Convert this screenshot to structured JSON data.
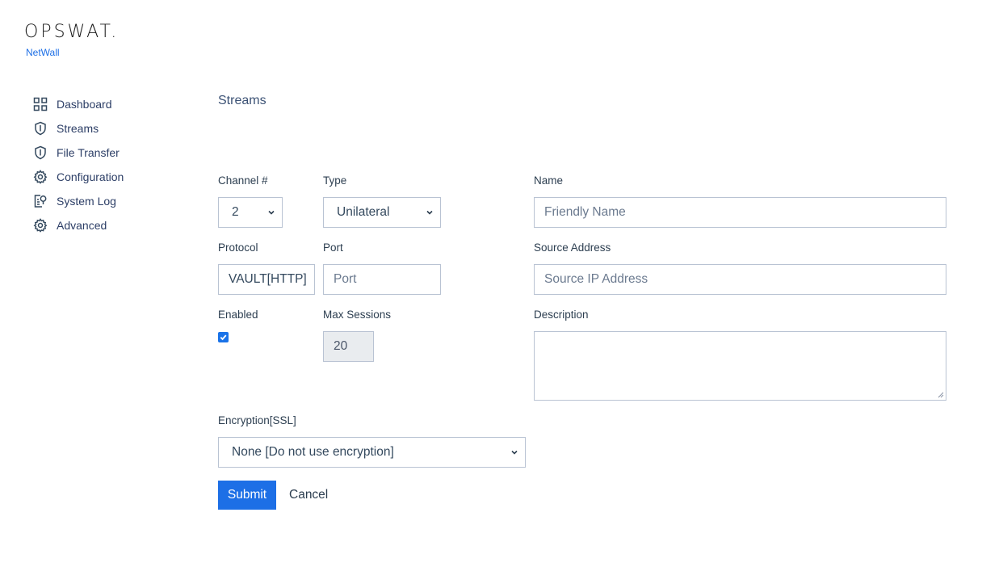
{
  "brand": {
    "name": "OPSWAT.",
    "product": "NetWall"
  },
  "sidebar": {
    "items": [
      {
        "label": "Dashboard",
        "icon": "dashboard-grid-icon"
      },
      {
        "label": "Streams",
        "icon": "shield-icon"
      },
      {
        "label": "File Transfer",
        "icon": "shield-icon"
      },
      {
        "label": "Configuration",
        "icon": "gear-icon"
      },
      {
        "label": "System Log",
        "icon": "log-search-icon"
      },
      {
        "label": "Advanced",
        "icon": "gear-icon"
      }
    ]
  },
  "page": {
    "title": "Streams"
  },
  "form": {
    "channel": {
      "label": "Channel #",
      "value": "2"
    },
    "type": {
      "label": "Type",
      "value": "Unilateral"
    },
    "name": {
      "label": "Name",
      "placeholder": "Friendly Name"
    },
    "protocol": {
      "label": "Protocol",
      "value": "VAULT[HTTP]"
    },
    "port": {
      "label": "Port",
      "placeholder": "Port"
    },
    "source_address": {
      "label": "Source Address",
      "placeholder": "Source IP Address"
    },
    "enabled": {
      "label": "Enabled",
      "checked": true
    },
    "max_sessions": {
      "label": "Max Sessions",
      "value": "20"
    },
    "description": {
      "label": "Description",
      "value": ""
    },
    "encryption": {
      "label": "Encryption[SSL]",
      "value": "None [Do not use encryption]"
    },
    "submit_label": "Submit",
    "cancel_label": "Cancel"
  },
  "colors": {
    "accent": "#1d6fe6",
    "border": "#b9c3d3",
    "disabled_bg": "#e9ecef"
  }
}
